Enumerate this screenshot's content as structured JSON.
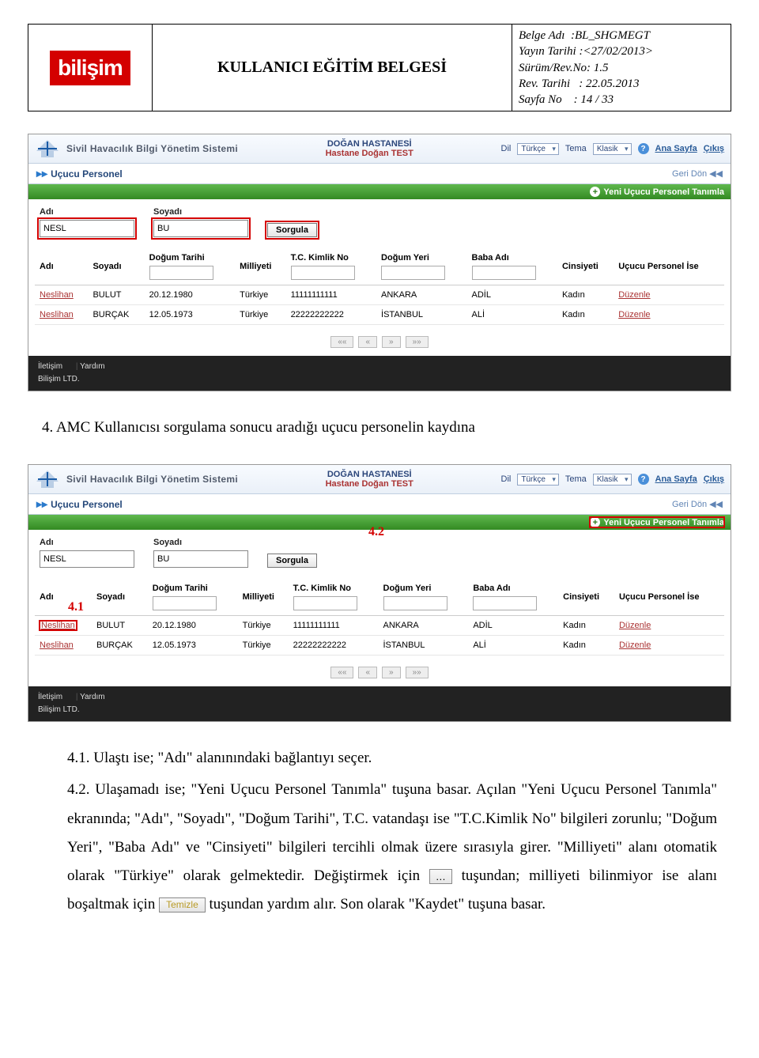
{
  "doc_header": {
    "logo_text": "bilişim",
    "title": "KULLANICI EĞİTİM BELGESİ",
    "meta": {
      "belge_label": "Belge Adı",
      "belge_value": ":BL_SHGMEGT",
      "yayin_label": "Yayın Tarihi",
      "yayin_value": ":<27/02/2013>",
      "surum_label": "Sürüm/Rev.No:",
      "surum_value": "1.5",
      "revt_label": "Rev. Tarihi",
      "revt_value": ": 22.05.2013",
      "sayfa_label": "Sayfa No",
      "sayfa_value": ": 14  /  33"
    }
  },
  "app_header": {
    "system_title": "Sivil Havacılık Bilgi Yönetim Sistemi",
    "hospital_line1": "DOĞAN HASTANESİ",
    "hospital_line2": "Hastane Doğan TEST",
    "dil_label": "Dil",
    "dil_value": "Türkçe",
    "tema_label": "Tema",
    "tema_value": "Klasik",
    "home_link": "Ana Sayfa",
    "logout_link": "Çıkış"
  },
  "crumb": {
    "title": "Uçucu Personel",
    "back": "Geri Dön"
  },
  "green_bar": {
    "new_btn": "Yeni Uçucu Personel Tanımla"
  },
  "search": {
    "adi_label": "Adı",
    "adi_value": "NESL",
    "soyadi_label": "Soyadı",
    "soyadi_value": "BU",
    "sorgula": "Sorgula"
  },
  "table": {
    "cols": {
      "adi": "Adı",
      "soyadi": "Soyadı",
      "dogum_tarihi": "Doğum Tarihi",
      "milliyeti": "Milliyeti",
      "tc": "T.C. Kimlik No",
      "dogum_yeri": "Doğum Yeri",
      "baba_adi": "Baba Adı",
      "cinsiyeti": "Cinsiyeti",
      "ise": "Uçucu Personel İse"
    },
    "rows": [
      {
        "adi": "Neslihan",
        "soyadi": "BULUT",
        "dogum_tarihi": "20.12.1980",
        "milliyeti": "Türkiye",
        "tc": "11111111111",
        "dogum_yeri": "ANKARA",
        "baba_adi": "ADİL",
        "cinsiyeti": "Kadın",
        "ise": "Düzenle"
      },
      {
        "adi": "Neslihan",
        "soyadi": "BURÇAK",
        "dogum_tarihi": "12.05.1973",
        "milliyeti": "Türkiye",
        "tc": "22222222222",
        "dogum_yeri": "İSTANBUL",
        "baba_adi": "ALİ",
        "cinsiyeti": "Kadın",
        "ise": "Düzenle"
      }
    ],
    "pager": {
      "first": "««",
      "prev": "«",
      "next": "»",
      "last": "»»"
    }
  },
  "footer": {
    "iletisim": "İletişim",
    "yardim": "Yardım",
    "ltd": "Bilişim LTD."
  },
  "annotations": {
    "a41": "4.1",
    "a42": "4.2"
  },
  "body": {
    "para4": "4. AMC Kullanıcısı sorgulama sonucu aradığı uçucu personelin kaydına",
    "li41": "4.1. Ulaştı ise; \"Adı\" alanınındaki bağlantıyı seçer.",
    "li42a": "4.2. Ulaşamadı ise; \"Yeni Uçucu Personel Tanımla\" tuşuna basar. Açılan \"Yeni Uçucu Personel Tanımla\" ekranında; \"Adı\", \"Soyadı\", \"Doğum Tarihi\", T.C. vatandaşı ise \"T.C.Kimlik No\" bilgileri zorunlu; \"Doğum Yeri\", \"Baba Adı\" ve \"Cinsiyeti\" bilgileri tercihli olmak üzere sırasıyla girer. \"Milliyeti\" alanı otomatik olarak \"Türkiye\" olarak gelmektedir. Değiştirmek için ",
    "li42b": " tuşundan; milliyeti bilinmiyor ise alanı boşaltmak için ",
    "li42c": " tuşundan yardım alır. Son olarak \"Kaydet\" tuşuna basar.",
    "btn_dots": "…",
    "btn_temizle": "Temizle"
  }
}
